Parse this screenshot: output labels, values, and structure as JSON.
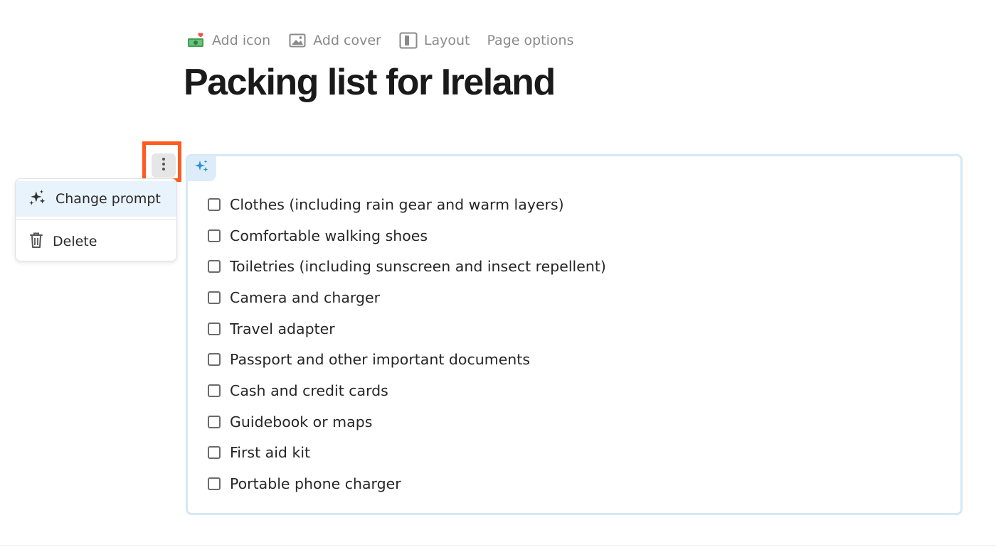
{
  "toolbar": {
    "add_icon_label": "Add icon",
    "add_cover_label": "Add cover",
    "layout_label": "Layout",
    "page_options_label": "Page options"
  },
  "page": {
    "title": "Packing list for Ireland"
  },
  "block_menu": {
    "items": [
      {
        "label": "Change prompt",
        "icon": "sparkles-icon"
      },
      {
        "label": "Delete",
        "icon": "trash-icon"
      }
    ]
  },
  "checklist": {
    "items": [
      {
        "label": "Clothes (including rain gear and warm layers)",
        "checked": false
      },
      {
        "label": "Comfortable walking shoes",
        "checked": false
      },
      {
        "label": "Toiletries (including sunscreen and insect repellent)",
        "checked": false
      },
      {
        "label": "Camera and charger",
        "checked": false
      },
      {
        "label": "Travel adapter",
        "checked": false
      },
      {
        "label": "Passport and other important documents",
        "checked": false
      },
      {
        "label": "Cash and credit cards",
        "checked": false
      },
      {
        "label": "Guidebook or maps",
        "checked": false
      },
      {
        "label": "First aid kit",
        "checked": false
      },
      {
        "label": "Portable phone charger",
        "checked": false
      }
    ]
  },
  "colors": {
    "highlight_frame": "#ff5a1f",
    "ai_block_border": "#d6e8f7",
    "ai_badge_bg": "#dcecf9",
    "sparkle_blue": "#2b8fd6",
    "menu_active_bg": "#e9f3fb"
  }
}
